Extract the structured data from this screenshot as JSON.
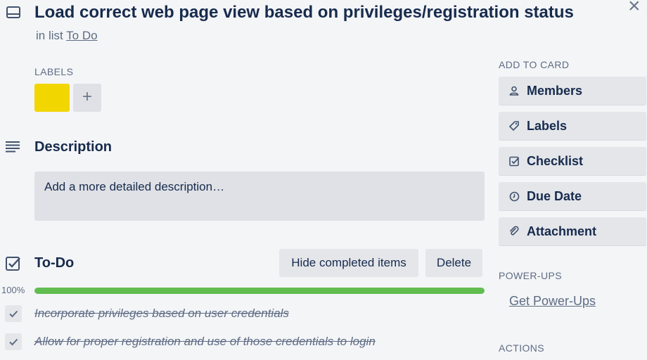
{
  "card": {
    "title": "Load correct web page view based on privileges/registration status",
    "in_list_prefix": "in list",
    "list_name": "To Do",
    "close_glyph": "×"
  },
  "labels_section": {
    "heading": "LABELS",
    "labels": [
      {
        "color": "#f2d600",
        "name": ""
      }
    ],
    "add_glyph": "+"
  },
  "description": {
    "heading": "Description",
    "placeholder": "Add a more detailed description…"
  },
  "checklist": {
    "title": "To-Do",
    "hide_completed_label": "Hide completed items",
    "delete_label": "Delete",
    "progress_text": "100%",
    "progress_value": 1.0,
    "items": [
      {
        "text": "Incorporate privileges based on user credentials",
        "checked": true
      },
      {
        "text": "Allow for proper registration and use of those credentials to login",
        "checked": true
      }
    ]
  },
  "sidebar": {
    "add_to_card_heading": "ADD TO CARD",
    "buttons": [
      {
        "label": "Members",
        "icon": "person-icon"
      },
      {
        "label": "Labels",
        "icon": "tag-icon"
      },
      {
        "label": "Checklist",
        "icon": "checkbox-icon"
      },
      {
        "label": "Due Date",
        "icon": "clock-icon"
      },
      {
        "label": "Attachment",
        "icon": "paperclip-icon"
      }
    ],
    "power_ups_heading": "POWER-UPS",
    "get_power_ups_label": "Get Power-Ups",
    "actions_heading": "ACTIONS"
  },
  "colors": {
    "accent_green": "#61bd4f",
    "label_yellow": "#f2d600",
    "text_dark": "#172b4d",
    "text_muted": "#5e6c84"
  }
}
